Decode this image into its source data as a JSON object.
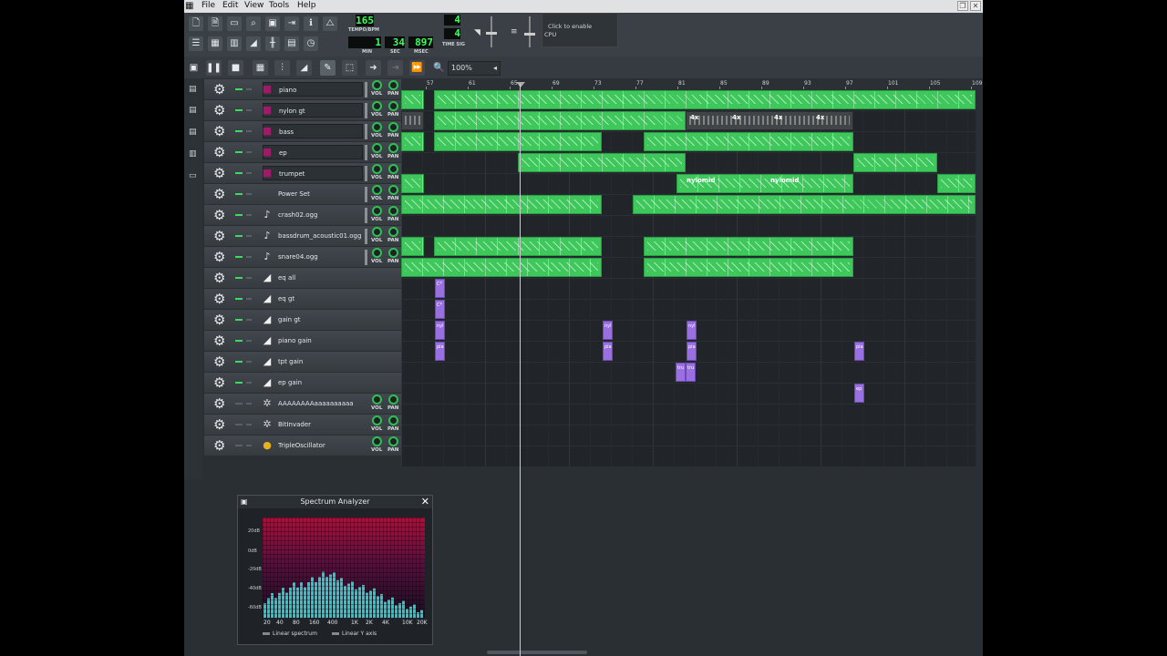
{
  "menu": [
    "File",
    "Edit",
    "View",
    "Tools",
    "Help"
  ],
  "transport": {
    "tempo": "165",
    "tempo_label": "TEMPO/BPM",
    "min": "1",
    "sec": "34",
    "msec": "897",
    "min_label": "MIN",
    "sec_label": "SEC",
    "msec_label": "MSEC",
    "timesig_num": "4",
    "timesig_den": "4",
    "timesig_label": "TIME SIG"
  },
  "cpu": {
    "hint": "Click to enable",
    "label": "CPU"
  },
  "song_editor": {
    "zoom": "100%"
  },
  "knob_labels": {
    "vol": "VOL",
    "pan": "PAN"
  },
  "ruler": [
    "57",
    "61",
    "65",
    "69",
    "73",
    "77",
    "81",
    "85",
    "89",
    "93",
    "97",
    "101",
    "105",
    "109"
  ],
  "tracks": [
    {
      "name": "piano",
      "type": "instrument",
      "selected": true,
      "muted": false
    },
    {
      "name": "nylon gt",
      "type": "instrument",
      "selected": true,
      "muted": false
    },
    {
      "name": "bass",
      "type": "instrument",
      "selected": true,
      "muted": false
    },
    {
      "name": "ep",
      "type": "instrument",
      "selected": true,
      "muted": false
    },
    {
      "name": "trumpet",
      "type": "instrument",
      "selected": true,
      "muted": false
    },
    {
      "name": "Power Set",
      "type": "instrument",
      "selected": false,
      "muted": false
    },
    {
      "name": "crash02.ogg",
      "type": "sample",
      "selected": false,
      "muted": false
    },
    {
      "name": "bassdrum_acoustic01.ogg",
      "type": "sample",
      "selected": false,
      "muted": false
    },
    {
      "name": "snare04.ogg",
      "type": "sample",
      "selected": false,
      "muted": false
    },
    {
      "name": "eq all",
      "type": "automation",
      "selected": false,
      "muted": false
    },
    {
      "name": "eq gt",
      "type": "automation",
      "selected": false,
      "muted": false
    },
    {
      "name": "gain gt",
      "type": "automation",
      "selected": false,
      "muted": false
    },
    {
      "name": "piano gain",
      "type": "automation",
      "selected": false,
      "muted": false
    },
    {
      "name": "tpt gain",
      "type": "automation",
      "selected": false,
      "muted": false
    },
    {
      "name": "ep gain",
      "type": "automation",
      "selected": false,
      "muted": false
    },
    {
      "name": "AAAAAAAAaaaaaaaaaa",
      "type": "fx",
      "selected": false,
      "muted": true
    },
    {
      "name": "BitInvader",
      "type": "fx",
      "selected": false,
      "muted": true
    },
    {
      "name": "TripleOscillator",
      "type": "synth",
      "selected": false,
      "muted": true
    }
  ],
  "clip_labels": {
    "repeat": "4x",
    "nylon": "nylomid",
    "auto_eq": "C*",
    "auto_gain": "nyl",
    "auto_piano": "pia",
    "auto_tpt": "tru",
    "auto_ep": "ep"
  },
  "spectrum": {
    "title": "Spectrum Analyzer",
    "db_labels": [
      "20dB",
      "0dB",
      "-20dB",
      "-40dB",
      "-60dB"
    ],
    "freq_labels": [
      "20",
      "40",
      "80",
      "160",
      "400",
      "1K",
      "2K",
      "4K",
      "10K",
      "20K"
    ],
    "options": [
      "Linear spectrum",
      "Linear Y axis"
    ]
  },
  "colors": {
    "clip": "#3ec85b",
    "automation": "#9a70e0",
    "lcd_text": "#3bff5b"
  },
  "icons": {
    "toolbar": [
      "new-project-icon",
      "new-from-template-icon",
      "open-project-icon",
      "recent-projects-icon",
      "save-project-icon",
      "export-icon",
      "whats-this-icon",
      "metronome-icon",
      "song-editor-icon",
      "beat-bassline-icon",
      "piano-roll-icon",
      "automation-editor-icon",
      "mixer-icon",
      "controller-rack-icon",
      "project-notes-icon"
    ],
    "editbar": [
      "export-video-icon",
      "pause-icon",
      "stop-icon",
      "add-beat-bassline-icon",
      "add-sample-track-icon",
      "add-automation-track-icon",
      "draw-mode-icon",
      "edit-mode-icon",
      "auto-scroll-icon",
      "loop-points-icon",
      "stop-behaviour-icon",
      "zoom-icon"
    ]
  }
}
